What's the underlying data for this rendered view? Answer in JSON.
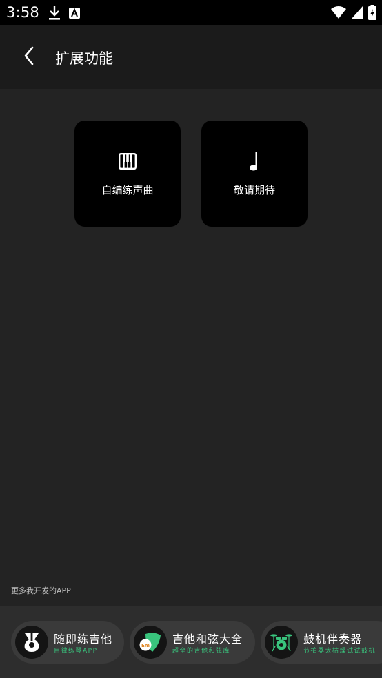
{
  "status_bar": {
    "time": "3:58",
    "left_icons": [
      "download-icon",
      "font-a-icon"
    ],
    "right_icons": [
      "wifi-icon",
      "signal-icon",
      "battery-icon"
    ]
  },
  "app_bar": {
    "title": "扩展功能",
    "back_icon": "back-chevron-icon"
  },
  "features": [
    {
      "label": "自编练声曲",
      "icon": "piano-icon"
    },
    {
      "label": "敬请期待",
      "icon": "music-note-icon"
    }
  ],
  "more_apps": {
    "label": "更多我开发的APP",
    "apps": [
      {
        "name": "随即练吉他",
        "subtitle": "自律练琴APP",
        "icon": "guitar-practice-icon"
      },
      {
        "name": "吉他和弦大全",
        "subtitle": "超全的吉他和弦库",
        "icon": "chord-pick-icon"
      },
      {
        "name": "鼓机伴奏器",
        "subtitle": "节拍器太枯燥试试鼓机",
        "icon": "drum-kit-icon"
      }
    ]
  },
  "colors": {
    "background": "#232323",
    "app_bar": "#1b1b1b",
    "card": "#000000",
    "accent_green": "#39c47d"
  }
}
